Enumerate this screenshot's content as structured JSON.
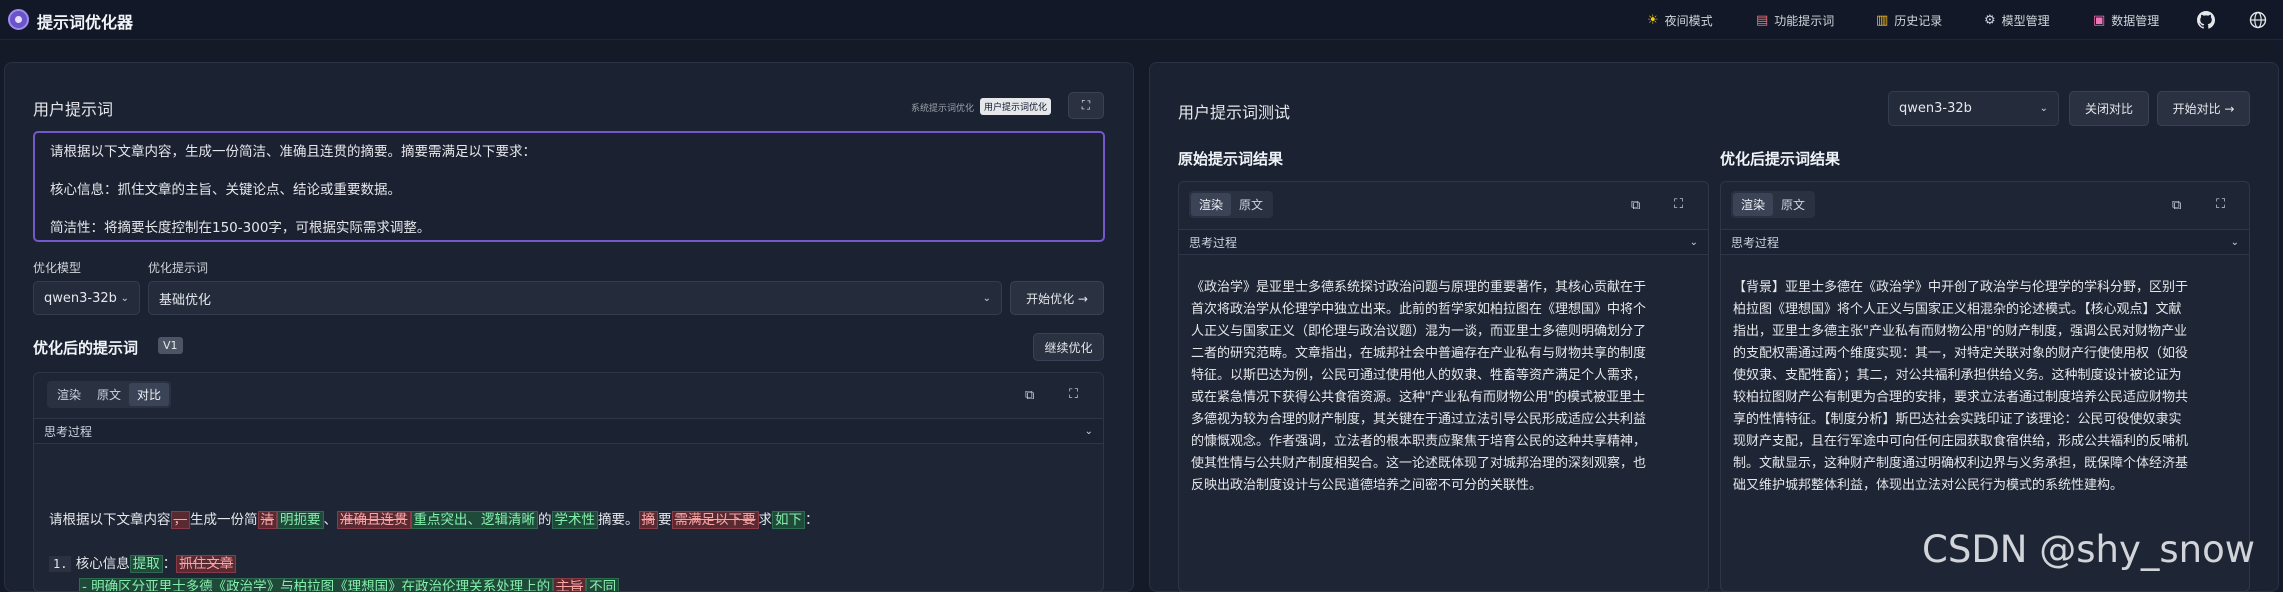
{
  "app": {
    "title": "提示词优化器",
    "logo_icon": "sparkle-logo"
  },
  "nav": [
    {
      "label": "夜间模式",
      "icon": "sun-icon"
    },
    {
      "label": "功能提示词",
      "icon": "document-icon"
    },
    {
      "label": "历史记录",
      "icon": "history-icon"
    },
    {
      "label": "模型管理",
      "icon": "gear-icon"
    },
    {
      "label": "数据管理",
      "icon": "database-icon"
    },
    {
      "label": "",
      "icon": "github-icon"
    },
    {
      "label": "",
      "icon": "globe-icon"
    }
  ],
  "left": {
    "title": "用户提示词",
    "mode_system": "系统提示词优化",
    "mode_user": "用户提示词优化",
    "prompt_lines": [
      "请根据以下文章内容，生成一份简洁、准确且连贯的摘要。摘要需满足以下要求：",
      "核心信息：抓住文章的主旨、关键论点、结论或重要数据。",
      "简洁性：将摘要长度控制在150-300字，可根据实际需求调整。"
    ],
    "model_label": "优化模型",
    "model_value": "qwen3-32b",
    "template_label": "优化提示词",
    "template_value": "基础优化",
    "optimize_button": "开始优化 →",
    "result_title": "优化后的提示词",
    "version_badge": "V1",
    "continue_button": "继续优化",
    "tabs": [
      "渲染",
      "原文",
      "对比"
    ],
    "active_tab": "对比",
    "thinking": "思考过程",
    "diff_segments": [
      {
        "t": "请根据以下文章内容",
        "k": "eq"
      },
      {
        "t": "，",
        "k": "del"
      },
      {
        "t": "生成一份简",
        "k": "eq"
      },
      {
        "t": "洁",
        "k": "del"
      },
      {
        "t": "明扼要",
        "k": "ins"
      },
      {
        "t": "、",
        "k": "eq"
      },
      {
        "t": "准确且连贯",
        "k": "del"
      },
      {
        "t": "重点突出、逻辑清晰",
        "k": "ins"
      },
      {
        "t": "的",
        "k": "eq"
      },
      {
        "t": "学术性",
        "k": "ins"
      },
      {
        "t": "摘要。",
        "k": "eq"
      },
      {
        "t": "摘",
        "k": "del"
      },
      {
        "t": "要",
        "k": "eq"
      },
      {
        "t": "需满足以下要",
        "k": "del"
      },
      {
        "t": "求",
        "k": "eq"
      },
      {
        "t": "如下",
        "k": "ins"
      },
      {
        "t": "：",
        "k": "eq"
      }
    ],
    "diff_line2_num": "1.",
    "diff_line2_segments": [
      {
        "t": "核心信息",
        "k": "eq"
      },
      {
        "t": "提取",
        "k": "ins"
      },
      {
        "t": "：",
        "k": "eq"
      },
      {
        "t": "抓住文章",
        "k": "del"
      }
    ],
    "diff_line3_segments": [
      {
        "t": "- 明确区分亚里士多德《政治学》与柏拉图《理想国》在政治伦理关系处理上的",
        "k": "ins"
      },
      {
        "t": "主旨",
        "k": "del"
      },
      {
        "t": "不同",
        "k": "ins"
      }
    ]
  },
  "right": {
    "title": "用户提示词测试",
    "model_value": "qwen3-32b",
    "close_compare": "关闭对比",
    "start_compare": "开始对比 →",
    "original_title": "原始提示词结果",
    "optimized_title": "优化后提示词结果",
    "tabs": [
      "渲染",
      "原文"
    ],
    "active_tab": "渲染",
    "thinking": "思考过程",
    "original_lines": [
      "《政治学》是亚里士多德系统探讨政治问题与原理的重要著作，其核心贡献在于",
      "首次将政治学从伦理学中独立出来。此前的哲学家如柏拉图在《理想国》中将个",
      "人正义与国家正义（即伦理与政治议题）混为一谈，而亚里士多德则明确划分了",
      "二者的研究范畴。文章指出，在城邦社会中普遍存在产业私有与财物共享的制度",
      "特征。以斯巴达为例，公民可通过使用他人的奴隶、牲畜等资产满足个人需求，",
      "或在紧急情况下获得公共食宿资源。这种\"产业私有而财物公用\"的模式被亚里士",
      "多德视为较为合理的财产制度，其关键在于通过立法引导公民形成适应公共利益",
      "的慷慨观念。作者强调，立法者的根本职责应聚焦于培育公民的这种共享精神，",
      "使其性情与公共财产制度相契合。这一论述既体现了对城邦治理的深刻观察，也",
      "反映出政治制度设计与公民道德培养之间密不可分的关联性。"
    ],
    "optimized_lines": [
      "【背景】亚里士多德在《政治学》中开创了政治学与伦理学的学科分野，区别于",
      "柏拉图《理想国》将个人正义与国家正义相混杂的论述模式。【核心观点】文献",
      "指出，亚里士多德主张\"产业私有而财物公用\"的财产制度，强调公民对财物产业",
      "的支配权需通过两个维度实现：其一，对特定关联对象的财产行使使用权（如役",
      "使奴隶、支配牲畜）；其二，对公共福利承担供给义务。这种制度设计被论证为",
      "较柏拉图财产公有制更为合理的安排，要求立法者通过制度培养公民适应财物共",
      "享的性情特征。【制度分析】斯巴达社会实践印证了该理论：公民可役使奴隶实",
      "现财产支配，且在行军途中可向任何庄园获取食宿供给，形成公共福利的反哺机",
      "制。文献显示，这种财产制度通过明确权利边界与义务承担，既保障个体经济基",
      "础又维护城邦整体利益，体现出立法对公民行为模式的系统性建构。"
    ]
  },
  "watermark": "CSDN @shy_snow"
}
